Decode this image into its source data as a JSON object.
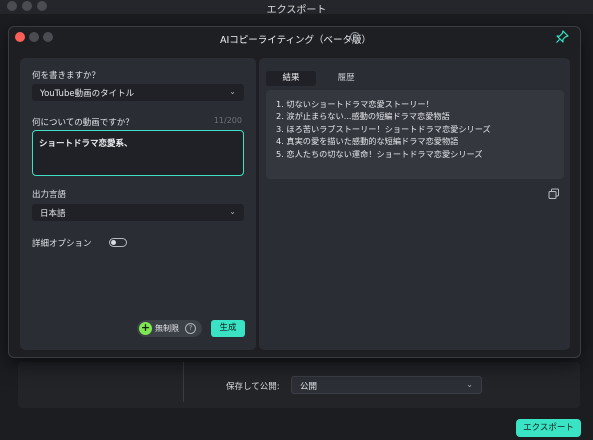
{
  "background_window": {
    "title": "エクスポート",
    "save_label": "保存して公開:",
    "save_value": "公開",
    "export_button": "エクスポート"
  },
  "dialog": {
    "title": "AIコピーライティング（ベータ版）",
    "help": "?",
    "left": {
      "what_label": "何を書きますか？",
      "what_value": "YouTube動画のタイトル",
      "topic_label": "何についての動画ですか？",
      "topic_counter": "11/200",
      "topic_value": "ショートドラマ恋愛系、",
      "language_label": "出力言語",
      "language_value": "日本語",
      "advanced_label": "詳細オプション",
      "advanced_on": false,
      "unlimited_label": "無制限",
      "generate_button": "生成"
    },
    "right": {
      "tabs": [
        {
          "label": "結果",
          "active": true
        },
        {
          "label": "履歴",
          "active": false
        }
      ],
      "results": [
        "1. 切ないショートドラマ恋愛ストーリー！",
        "2. 涙が止まらない...感動の短編ドラマ恋愛物語",
        "3. ほろ苦いラブストーリー！ショートドラマ恋愛シリーズ",
        "4. 真実の愛を描いた感動的な短編ドラマ恋愛物語",
        "5. 恋人たちの切ない運命！ショートドラマ恋愛シリーズ"
      ]
    }
  },
  "colors": {
    "accent": "#39e3c4",
    "close_red": "#fe5f57",
    "unlimited_green": "#7de84f"
  },
  "icons": [
    "help-icon",
    "pin-icon",
    "chevron-down-icon",
    "plus-icon",
    "question-icon",
    "copy-icon"
  ]
}
